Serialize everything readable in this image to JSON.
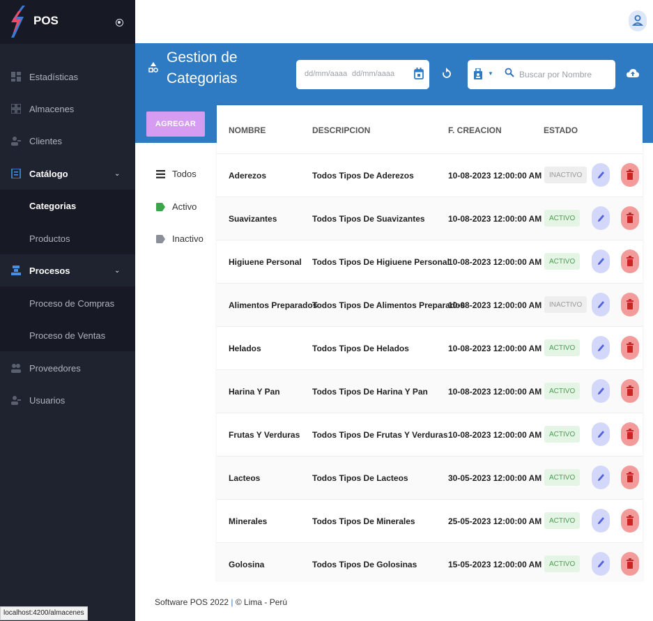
{
  "app": {
    "name": "POS",
    "status_url": "localhost:4200/almacenes"
  },
  "sidebar": {
    "items": [
      {
        "label": "Estadísticas",
        "icon": "dashboard-icon"
      },
      {
        "label": "Almacenes",
        "icon": "warehouse-icon"
      },
      {
        "label": "Clientes",
        "icon": "clients-icon"
      },
      {
        "label": "Catálogo",
        "icon": "catalog-icon",
        "expanded": true,
        "children": [
          {
            "label": "Categorias",
            "active": true
          },
          {
            "label": "Productos"
          }
        ]
      },
      {
        "label": "Procesos",
        "icon": "process-icon",
        "expanded": true,
        "children": [
          {
            "label": "Proceso de Compras"
          },
          {
            "label": "Proceso de Ventas"
          }
        ]
      },
      {
        "label": "Proveedores",
        "icon": "providers-icon"
      },
      {
        "label": "Usuarios",
        "icon": "users-icon"
      }
    ]
  },
  "header": {
    "title": "Gestion de Categorias",
    "title_line1": "Gestion de",
    "title_line2": "Categorias",
    "date_from_placeholder": "dd/mm/aaaa",
    "date_to_placeholder": "dd/mm/aaaa",
    "search_placeholder": "Buscar por Nombre"
  },
  "actions": {
    "add_label": "AGREGAR"
  },
  "filters": [
    {
      "label": "Todos",
      "icon": "list-icon"
    },
    {
      "label": "Activo",
      "icon": "tag-green-icon"
    },
    {
      "label": "Inactivo",
      "icon": "tag-gray-icon"
    }
  ],
  "table": {
    "columns": [
      "NOMBRE",
      "DESCRIPCION",
      "F. CREACION",
      "ESTADO"
    ],
    "rows": [
      {
        "nombre": "Aderezos",
        "descripcion": "Todos Tipos De Aderezos",
        "fecha": "10-08-2023 12:00:00 AM",
        "estado": "INACTIVO"
      },
      {
        "nombre": "Suavizantes",
        "descripcion": "Todos Tipos De Suavizantes",
        "fecha": "10-08-2023 12:00:00 AM",
        "estado": "ACTIVO"
      },
      {
        "nombre": "Higiuene Personal",
        "descripcion": "Todos Tipos De Higiuene Personal",
        "fecha": "10-08-2023 12:00:00 AM",
        "estado": "ACTIVO"
      },
      {
        "nombre": "Alimentos Preparados",
        "descripcion": "Todos Tipos De Alimentos Preparados",
        "fecha": "10-08-2023 12:00:00 AM",
        "estado": "INACTIVO"
      },
      {
        "nombre": "Helados",
        "descripcion": "Todos Tipos De Helados",
        "fecha": "10-08-2023 12:00:00 AM",
        "estado": "ACTIVO"
      },
      {
        "nombre": "Harina Y Pan",
        "descripcion": "Todos Tipos De Harina Y Pan",
        "fecha": "10-08-2023 12:00:00 AM",
        "estado": "ACTIVO"
      },
      {
        "nombre": "Frutas Y Verduras",
        "descripcion": "Todos Tipos De Frutas Y Verduras",
        "fecha": "10-08-2023 12:00:00 AM",
        "estado": "ACTIVO"
      },
      {
        "nombre": "Lacteos",
        "descripcion": "Todos Tipos De Lacteos",
        "fecha": "30-05-2023 12:00:00 AM",
        "estado": "ACTIVO"
      },
      {
        "nombre": "Minerales",
        "descripcion": "Todos Tipos De Minerales",
        "fecha": "25-05-2023 12:00:00 AM",
        "estado": "ACTIVO"
      },
      {
        "nombre": "Golosina",
        "descripcion": "Todos Tipos De Golosinas",
        "fecha": "15-05-2023 12:00:00 AM",
        "estado": "ACTIVO"
      }
    ]
  },
  "footer": {
    "text": "Software POS 2022",
    "sep": "|",
    "location": "© Lima - Perú"
  },
  "colors": {
    "sidebar": "#1f2330",
    "header_band": "#2e7bc4",
    "add_button": "#d59cf2",
    "active_badge": "#4b9b50",
    "edit_button": "#d3d8fa",
    "delete_button": "#f39a9a"
  }
}
